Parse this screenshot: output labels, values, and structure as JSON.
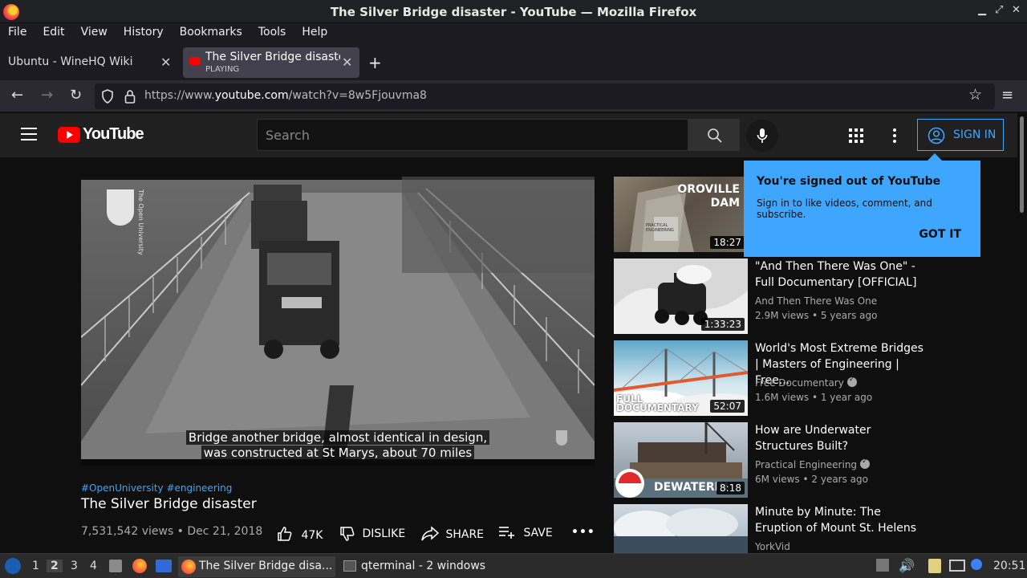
{
  "window": {
    "title": "The Silver Bridge disaster - YouTube — Mozilla Firefox"
  },
  "menu": [
    "File",
    "Edit",
    "View",
    "History",
    "Bookmarks",
    "Tools",
    "Help"
  ],
  "tabs": [
    {
      "label": "Ubuntu - WineHQ Wiki"
    },
    {
      "label": "The Silver Bridge disaster - YouTube",
      "status": "PLAYING"
    }
  ],
  "url": {
    "prefix": "https://www.",
    "domain": "youtube.com",
    "path": "/watch?v=8w5Fjouvma8"
  },
  "yt": {
    "logo": "YouTube",
    "search_placeholder": "Search",
    "sign_in": "SIGN IN"
  },
  "popup": {
    "heading": "You're signed out of YouTube",
    "body": "Sign in to like videos, comment, and subscribe.",
    "button": "GOT IT"
  },
  "video": {
    "caption_line1": "Bridge another bridge, almost identical in design,",
    "caption_line2": "was constructed at St Marys, about 70 miles",
    "watermark": "The Open University",
    "hashtags": "#OpenUniversity #engineering",
    "title": "The Silver Bridge disaster",
    "views_date": "7,531,542 views • Dec 21, 2018",
    "likes": "47K",
    "dislike": "DISLIKE",
    "share": "SHARE",
    "save": "SAVE"
  },
  "recommendations": [
    {
      "title": "",
      "channel": "",
      "meta": "",
      "duration": "18:27",
      "thumb_text": "OROVILLE DAM",
      "thumb_sub": "PRACTICAL ENGINEERING",
      "verified": false
    },
    {
      "title": "\"And Then There Was One\" - Full Documentary [OFFICIAL]",
      "channel": "And Then There Was One",
      "meta": "2.9M views • 5 years ago",
      "duration": "1:33:23",
      "verified": false
    },
    {
      "title": "World's Most Extreme Bridges | Masters of Engineering | Free...",
      "channel": "Free Documentary",
      "meta": "1.6M views • 1 year ago",
      "duration": "52:07",
      "thumb_text": "FULL DOCUMENTARY",
      "verified": true
    },
    {
      "title": "How are Underwater Structures Built?",
      "channel": "Practical Engineering",
      "meta": "6M views • 2 years ago",
      "duration": "8:18",
      "thumb_text": "DEWATERIN",
      "verified": true
    },
    {
      "title": "Minute by Minute: The Eruption of Mount St. Helens",
      "channel": "YorkVid",
      "meta": "",
      "duration": "",
      "verified": false
    }
  ],
  "taskbar": {
    "workspaces": [
      "1",
      "2",
      "3",
      "4"
    ],
    "apps": [
      "The Silver Bridge disa...",
      "qterminal - 2 windows"
    ],
    "clock": "20:51"
  },
  "colors": {
    "accent": "#3ea6ff",
    "brand": "#ff0000",
    "bg": "#0f0f0f"
  }
}
